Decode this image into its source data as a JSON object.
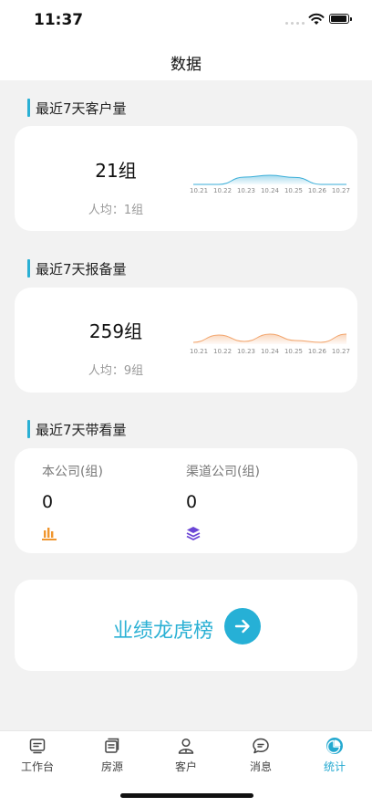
{
  "status": {
    "time": "11:37"
  },
  "nav": {
    "title": "数据"
  },
  "sections": {
    "customers": {
      "title": "最近7天客户量",
      "value": "21组",
      "avg": "人均：1组",
      "dates": [
        "10.21",
        "10.22",
        "10.23",
        "10.24",
        "10.25",
        "10.26",
        "10.27"
      ],
      "values": [
        0,
        0,
        0.4,
        0.5,
        0.38,
        0,
        0
      ],
      "color": "#3aaed8"
    },
    "reports": {
      "title": "最近7天报备量",
      "value": "259组",
      "avg": "人均：9组",
      "dates": [
        "10.21",
        "10.22",
        "10.23",
        "10.24",
        "10.25",
        "10.26",
        "10.27"
      ],
      "values": [
        0.1,
        0.5,
        0.15,
        0.55,
        0.2,
        0.1,
        0.55
      ],
      "color": "#f2a46b"
    },
    "visits": {
      "title": "最近7天带看量",
      "own_label": "本公司(组)",
      "own_value": "0",
      "channel_label": "渠道公司(组)",
      "channel_value": "0",
      "own_icon": "bar-chart-icon",
      "channel_icon": "layers-icon"
    }
  },
  "rank": {
    "label": "业绩龙虎榜",
    "icon": "arrow-right-icon"
  },
  "tabs": [
    {
      "label": "工作台",
      "icon": "workbench-icon"
    },
    {
      "label": "房源",
      "icon": "house-source-icon"
    },
    {
      "label": "客户",
      "icon": "customer-icon"
    },
    {
      "label": "消息",
      "icon": "message-icon"
    },
    {
      "label": "统计",
      "icon": "statistics-icon",
      "active": true
    }
  ]
}
